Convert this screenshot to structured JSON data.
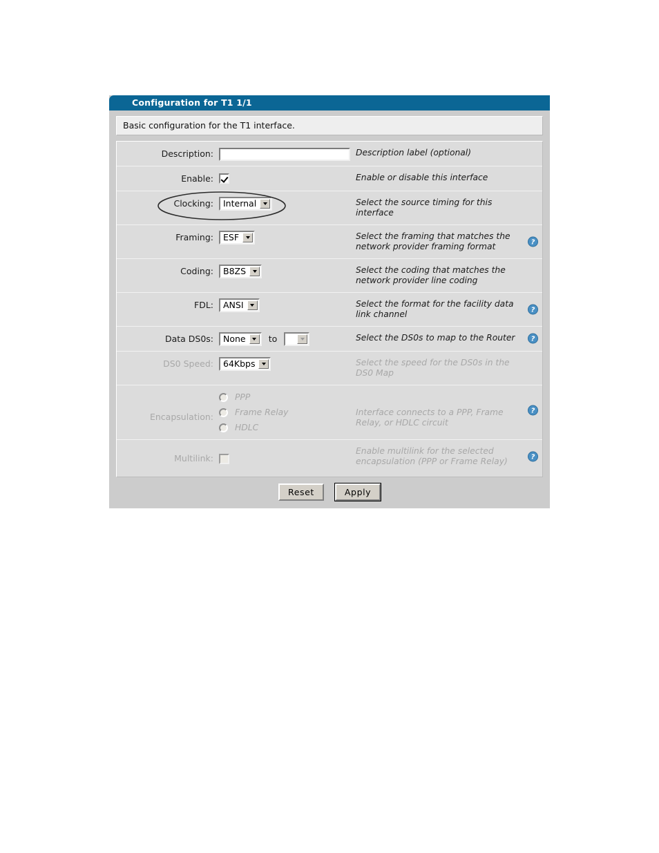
{
  "window": {
    "title": "Configuration for T1 1/1",
    "subtitle": "Basic configuration for the T1 interface."
  },
  "rows": {
    "description": {
      "label": "Description:",
      "value": "",
      "placeholder": "",
      "desc": "Description label (optional)"
    },
    "enable": {
      "label": "Enable:",
      "checked": "checked",
      "desc": "Enable or disable this interface"
    },
    "clocking": {
      "label": "Clocking:",
      "value": "Internal",
      "desc": "Select the source timing for this interface",
      "annotated": "true"
    },
    "framing": {
      "label": "Framing:",
      "value": "ESF",
      "desc": "Select the framing that matches the network provider framing format"
    },
    "coding": {
      "label": "Coding:",
      "value": "B8ZS",
      "desc": "Select the coding that matches the network provider line coding"
    },
    "fdl": {
      "label": "FDL:",
      "value": "ANSI",
      "desc": "Select the format for the facility data link channel"
    },
    "data_ds0s": {
      "label": "Data DS0s:",
      "value_from": "None",
      "separator": "to",
      "value_to": "",
      "desc": "Select the DS0s to map to the Router"
    },
    "ds0_speed": {
      "label": "DS0 Speed:",
      "value": "64Kbps",
      "desc": "Select the speed for the DS0s in the DS0 Map"
    },
    "encapsulation": {
      "label": "Encapsulation:",
      "options": [
        "PPP",
        "Frame Relay",
        "HDLC"
      ],
      "desc": "Interface connects to a PPP, Frame Relay, or HDLC circuit"
    },
    "multilink": {
      "label": "Multilink:",
      "checked": "",
      "desc": "Enable multilink for the selected encapsulation (PPP or Frame Relay)"
    }
  },
  "footer": {
    "reset_label": "Reset",
    "apply_label": "Apply"
  },
  "icons": {
    "help": "help-question-icon"
  },
  "colors": {
    "titlebar": "#0b6695",
    "panel": "#cccccc",
    "row": "#dcdcdc",
    "subtitle": "#eeeeee",
    "help_icon": "#4a90c4",
    "disabled_text": "#a8a8a8"
  }
}
